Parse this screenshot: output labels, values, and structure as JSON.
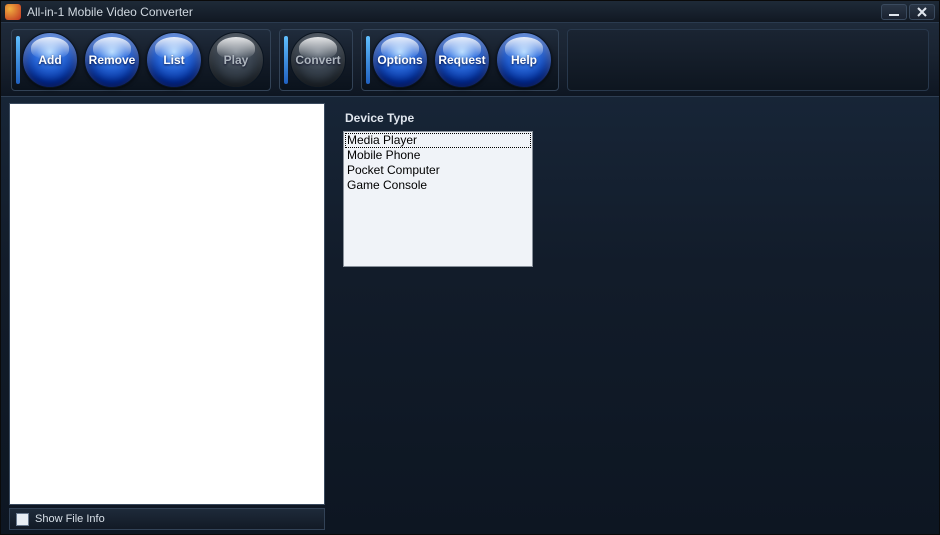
{
  "window": {
    "title": "All-in-1 Mobile Video Converter"
  },
  "toolbar": {
    "group1": [
      {
        "id": "add",
        "label": "Add",
        "enabled": true
      },
      {
        "id": "remove",
        "label": "Remove",
        "enabled": true
      },
      {
        "id": "list",
        "label": "List",
        "enabled": true
      },
      {
        "id": "play",
        "label": "Play",
        "enabled": false
      }
    ],
    "group2": [
      {
        "id": "convert",
        "label": "Convert",
        "enabled": false
      }
    ],
    "group3": [
      {
        "id": "options",
        "label": "Options",
        "enabled": true
      },
      {
        "id": "request",
        "label": "Request",
        "enabled": true
      },
      {
        "id": "help",
        "label": "Help",
        "enabled": true
      }
    ]
  },
  "left": {
    "show_file_info_label": "Show File Info",
    "show_file_info_checked": false
  },
  "right": {
    "device_type_label": "Device Type",
    "device_type_items": [
      "Media Player",
      "Mobile Phone",
      "Pocket Computer",
      "Game Console"
    ],
    "device_type_selected_index": 0
  }
}
